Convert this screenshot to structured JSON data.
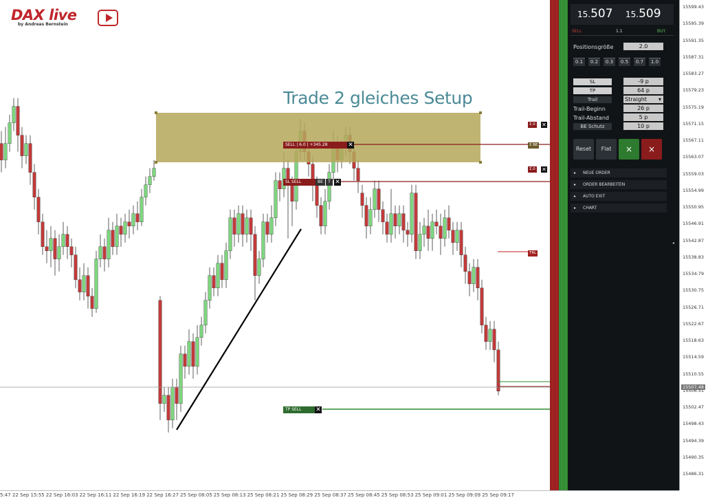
{
  "logo": {
    "name": "DAX live",
    "subtitle": "by Andreas Bernstein"
  },
  "annotation": "Trade 2 gleiches Setup",
  "colors": {
    "bull": "#7ed67e",
    "bear": "#c23a3a",
    "zone": "#b5a75a",
    "panel": "#111417",
    "tp_line": "#2e8b2e",
    "sl_line": "#8a1c1c"
  },
  "chart": {
    "orders": {
      "sell_label": "SELL | 6.0 | +345.28",
      "sl_label": "SL SELL",
      "be_label": "BE",
      "t_label": "T",
      "tp_label": "TP SELL",
      "trl_label": "TRL",
      "z0_label": "Σ.0",
      "z_be_label": "Σ BE"
    }
  },
  "xaxis": [
    "5:47",
    "22 Sep 15:55",
    "22 Sep 16:03",
    "22 Sep 16:11",
    "22 Sep 16:19",
    "22 Sep 16:27",
    "25 Sep 08:05",
    "25 Sep 08:13",
    "25 Sep 08:21",
    "25 Sep 08:29",
    "25 Sep 08:37",
    "25 Sep 08:45",
    "25 Sep 08:53",
    "25 Sep 09:01",
    "25 Sep 09:09",
    "25 Sep 09:17"
  ],
  "yaxis": [
    "15599.43",
    "15595.39",
    "15591.35",
    "15587.31",
    "15583.27",
    "15579.23",
    "15575.19",
    "15571.15",
    "15567.11",
    "15563.07",
    "15559.03",
    "15554.99",
    "15550.95",
    "15546.91",
    "15542.87",
    "15538.83",
    "15534.79",
    "15530.75",
    "15526.71",
    "15522.67",
    "15518.63",
    "15514.59",
    "15510.55",
    "15506.51",
    "15502.47",
    "15498.43",
    "15494.39",
    "15490.35",
    "15486.31"
  ],
  "yaxis_current": "15507.48",
  "panel": {
    "bid": {
      "main": "15.",
      "big": "507"
    },
    "ask": {
      "main": "15.",
      "big": "509"
    },
    "sell": "SELL",
    "spread": "1.1",
    "buy": "BUY",
    "position_label": "Positionsgröße",
    "position_value": "2.0",
    "quick_sizes": [
      "0.1",
      "0.2",
      "0.3",
      "0.5",
      "0.7",
      "1.0"
    ],
    "sl_label": "SL",
    "sl_value": "-9 p",
    "tp_label": "TP",
    "tp_value": "64 p",
    "trail_label": "Trail",
    "trail_value": "Straight",
    "trail_begin_label": "Trail-Beginn",
    "trail_begin_value": "26 p",
    "trail_dist_label": "Trail-Abstand",
    "trail_dist_value": "5 p",
    "be_label": "BE Schutz",
    "be_value": "10 p",
    "reset": "Reset",
    "flat": "Flat",
    "buy_btn": "×",
    "sell_btn": "×",
    "menu": [
      "NEUE ORDER",
      "ORDER BEARBEITEN",
      "AUTO EXIT",
      "CHART"
    ]
  }
}
